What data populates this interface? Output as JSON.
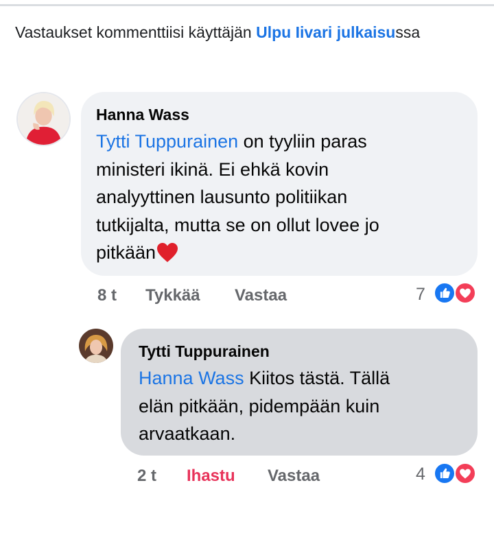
{
  "notice": {
    "prefix": "Vastaukset kommenttiisi käyttäjän ",
    "owner_link": "Ulpu Iivari",
    "post_link": "julkaisu",
    "suffix": "ssa"
  },
  "comments": [
    {
      "author": "Hanna Wass",
      "mention": "Tytti Tuppurainen",
      "line1": " on tyyliin paras",
      "lines": [
        "ministeri ikinä. Ei ehkä kovin",
        "analyyttinen lausunto politiikan",
        "tutkijalta, mutta se on ollut lovee jo"
      ],
      "last_line": "pitkään",
      "emoji": "heart",
      "time": "8 t",
      "action_react": "Tykkää",
      "action_reply": "Vastaa",
      "reaction_count": "7",
      "reactions": [
        "like-icon",
        "love-icon"
      ]
    },
    {
      "author": "Tytti Tuppurainen",
      "mention": "Hanna Wass",
      "line1": " Kiitos tästä. Tällä",
      "lines": [
        "elän pitkään, pidempään kuin",
        "arvaatkaan."
      ],
      "time": "2 t",
      "action_react": "Ihastu",
      "action_reply": "Vastaa",
      "reaction_count": "4",
      "reactions": [
        "like-icon",
        "love-icon"
      ]
    }
  ],
  "colors": {
    "link": "#1b74e4",
    "meta": "#65676b",
    "love": "#e8335a",
    "like_badge": "#1877f2",
    "love_badge": "#f33e58"
  }
}
